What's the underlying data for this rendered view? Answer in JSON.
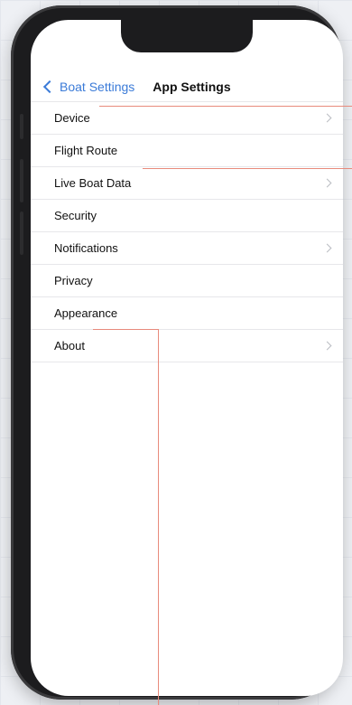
{
  "nav": {
    "back_label": "Boat Settings",
    "title": "App Settings"
  },
  "settings": {
    "items": [
      {
        "label": "Device",
        "chevron": true
      },
      {
        "label": "Flight Route",
        "chevron": false
      },
      {
        "label": "Live Boat Data",
        "chevron": true
      },
      {
        "label": "Security",
        "chevron": false
      },
      {
        "label": "Notifications",
        "chevron": true
      },
      {
        "label": "Privacy",
        "chevron": false
      },
      {
        "label": "Appearance",
        "chevron": false
      },
      {
        "label": "About",
        "chevron": true
      }
    ]
  },
  "colors": {
    "accent": "#3b7bd8",
    "callout": "#e88a7c"
  }
}
